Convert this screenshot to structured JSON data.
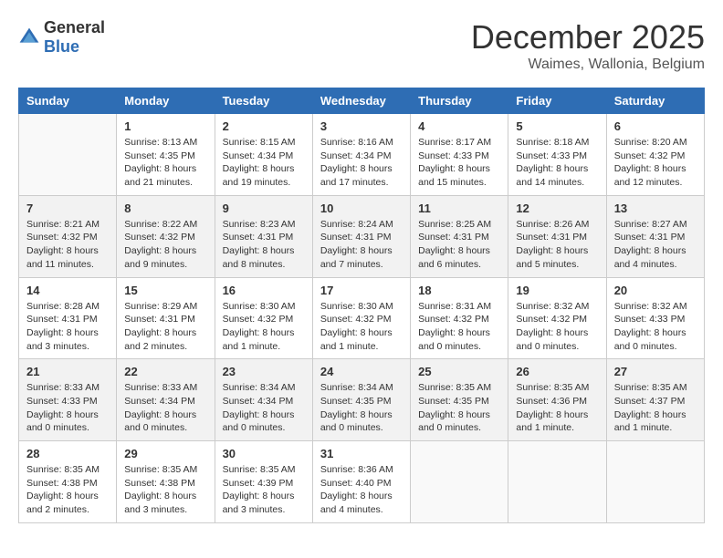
{
  "header": {
    "logo_general": "General",
    "logo_blue": "Blue",
    "month_title": "December 2025",
    "location": "Waimes, Wallonia, Belgium"
  },
  "days_of_week": [
    "Sunday",
    "Monday",
    "Tuesday",
    "Wednesday",
    "Thursday",
    "Friday",
    "Saturday"
  ],
  "weeks": [
    [
      {
        "day": "",
        "info": ""
      },
      {
        "day": "1",
        "info": "Sunrise: 8:13 AM\nSunset: 4:35 PM\nDaylight: 8 hours\nand 21 minutes."
      },
      {
        "day": "2",
        "info": "Sunrise: 8:15 AM\nSunset: 4:34 PM\nDaylight: 8 hours\nand 19 minutes."
      },
      {
        "day": "3",
        "info": "Sunrise: 8:16 AM\nSunset: 4:34 PM\nDaylight: 8 hours\nand 17 minutes."
      },
      {
        "day": "4",
        "info": "Sunrise: 8:17 AM\nSunset: 4:33 PM\nDaylight: 8 hours\nand 15 minutes."
      },
      {
        "day": "5",
        "info": "Sunrise: 8:18 AM\nSunset: 4:33 PM\nDaylight: 8 hours\nand 14 minutes."
      },
      {
        "day": "6",
        "info": "Sunrise: 8:20 AM\nSunset: 4:32 PM\nDaylight: 8 hours\nand 12 minutes."
      }
    ],
    [
      {
        "day": "7",
        "info": "Sunrise: 8:21 AM\nSunset: 4:32 PM\nDaylight: 8 hours\nand 11 minutes."
      },
      {
        "day": "8",
        "info": "Sunrise: 8:22 AM\nSunset: 4:32 PM\nDaylight: 8 hours\nand 9 minutes."
      },
      {
        "day": "9",
        "info": "Sunrise: 8:23 AM\nSunset: 4:31 PM\nDaylight: 8 hours\nand 8 minutes."
      },
      {
        "day": "10",
        "info": "Sunrise: 8:24 AM\nSunset: 4:31 PM\nDaylight: 8 hours\nand 7 minutes."
      },
      {
        "day": "11",
        "info": "Sunrise: 8:25 AM\nSunset: 4:31 PM\nDaylight: 8 hours\nand 6 minutes."
      },
      {
        "day": "12",
        "info": "Sunrise: 8:26 AM\nSunset: 4:31 PM\nDaylight: 8 hours\nand 5 minutes."
      },
      {
        "day": "13",
        "info": "Sunrise: 8:27 AM\nSunset: 4:31 PM\nDaylight: 8 hours\nand 4 minutes."
      }
    ],
    [
      {
        "day": "14",
        "info": "Sunrise: 8:28 AM\nSunset: 4:31 PM\nDaylight: 8 hours\nand 3 minutes."
      },
      {
        "day": "15",
        "info": "Sunrise: 8:29 AM\nSunset: 4:31 PM\nDaylight: 8 hours\nand 2 minutes."
      },
      {
        "day": "16",
        "info": "Sunrise: 8:30 AM\nSunset: 4:32 PM\nDaylight: 8 hours\nand 1 minute."
      },
      {
        "day": "17",
        "info": "Sunrise: 8:30 AM\nSunset: 4:32 PM\nDaylight: 8 hours\nand 1 minute."
      },
      {
        "day": "18",
        "info": "Sunrise: 8:31 AM\nSunset: 4:32 PM\nDaylight: 8 hours\nand 0 minutes."
      },
      {
        "day": "19",
        "info": "Sunrise: 8:32 AM\nSunset: 4:32 PM\nDaylight: 8 hours\nand 0 minutes."
      },
      {
        "day": "20",
        "info": "Sunrise: 8:32 AM\nSunset: 4:33 PM\nDaylight: 8 hours\nand 0 minutes."
      }
    ],
    [
      {
        "day": "21",
        "info": "Sunrise: 8:33 AM\nSunset: 4:33 PM\nDaylight: 8 hours\nand 0 minutes."
      },
      {
        "day": "22",
        "info": "Sunrise: 8:33 AM\nSunset: 4:34 PM\nDaylight: 8 hours\nand 0 minutes."
      },
      {
        "day": "23",
        "info": "Sunrise: 8:34 AM\nSunset: 4:34 PM\nDaylight: 8 hours\nand 0 minutes."
      },
      {
        "day": "24",
        "info": "Sunrise: 8:34 AM\nSunset: 4:35 PM\nDaylight: 8 hours\nand 0 minutes."
      },
      {
        "day": "25",
        "info": "Sunrise: 8:35 AM\nSunset: 4:35 PM\nDaylight: 8 hours\nand 0 minutes."
      },
      {
        "day": "26",
        "info": "Sunrise: 8:35 AM\nSunset: 4:36 PM\nDaylight: 8 hours\nand 1 minute."
      },
      {
        "day": "27",
        "info": "Sunrise: 8:35 AM\nSunset: 4:37 PM\nDaylight: 8 hours\nand 1 minute."
      }
    ],
    [
      {
        "day": "28",
        "info": "Sunrise: 8:35 AM\nSunset: 4:38 PM\nDaylight: 8 hours\nand 2 minutes."
      },
      {
        "day": "29",
        "info": "Sunrise: 8:35 AM\nSunset: 4:38 PM\nDaylight: 8 hours\nand 3 minutes."
      },
      {
        "day": "30",
        "info": "Sunrise: 8:35 AM\nSunset: 4:39 PM\nDaylight: 8 hours\nand 3 minutes."
      },
      {
        "day": "31",
        "info": "Sunrise: 8:36 AM\nSunset: 4:40 PM\nDaylight: 8 hours\nand 4 minutes."
      },
      {
        "day": "",
        "info": ""
      },
      {
        "day": "",
        "info": ""
      },
      {
        "day": "",
        "info": ""
      }
    ]
  ]
}
